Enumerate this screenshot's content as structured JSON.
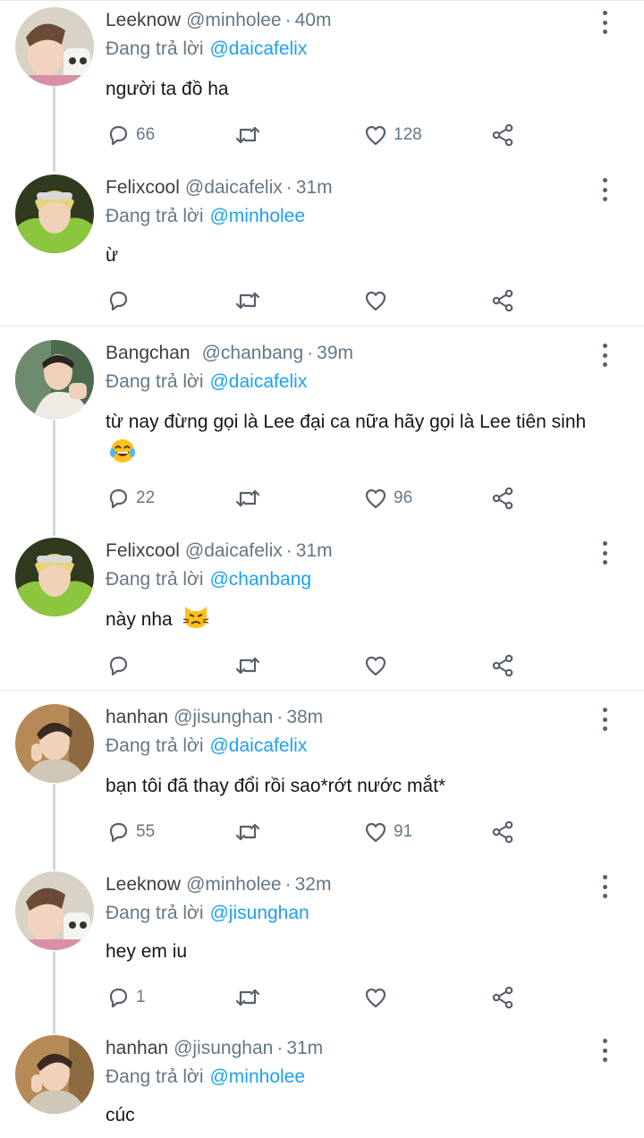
{
  "reply_prefix": "Đang trả lời",
  "colors": {
    "accent": "#1da1f2",
    "muted": "#657786",
    "divider": "#e1e8ed",
    "thread_line": "#cfd9de"
  },
  "icons": {
    "reply": "reply-bubble-icon",
    "retweet": "retweet-icon",
    "like": "heart-icon",
    "share": "share-icon",
    "more": "more-vertical-icon"
  },
  "tweets": [
    {
      "name": "Leeknow",
      "handle": "@minholee",
      "time": "40m",
      "reply_to": "@daicafelix",
      "text": "người ta đồ ha",
      "replies": "66",
      "likes": "128"
    },
    {
      "name": "Felixcool",
      "handle": "@daicafelix",
      "time": "31m",
      "reply_to": "@minholee",
      "text": "ừ",
      "replies": "",
      "likes": ""
    },
    {
      "name": "Bangchan",
      "handle": "@chanbang",
      "time": "39m",
      "reply_to": "@daicafelix",
      "text": "từ nay đừng gọi là Lee đại ca nữa hãy gọi là Lee tiên sinh",
      "emoji": "😂",
      "replies": "22",
      "likes": "96"
    },
    {
      "name": "Felixcool",
      "handle": "@daicafelix",
      "time": "31m",
      "reply_to": "@chanbang",
      "text": "này nha",
      "emoji": "😾",
      "replies": "",
      "likes": ""
    },
    {
      "name": "hanhan",
      "handle": "@jisunghan",
      "time": "38m",
      "reply_to": "@daicafelix",
      "text": "bạn tôi đã thay đổi rồi sao*rớt nước mắt*",
      "replies": "55",
      "likes": "91"
    },
    {
      "name": "Leeknow",
      "handle": "@minholee",
      "time": "32m",
      "reply_to": "@jisunghan",
      "text": "hey em iu",
      "replies": "1",
      "likes": ""
    },
    {
      "name": "hanhan",
      "handle": "@jisunghan",
      "time": "31m",
      "reply_to": "@minholee",
      "text": "cúc"
    }
  ]
}
